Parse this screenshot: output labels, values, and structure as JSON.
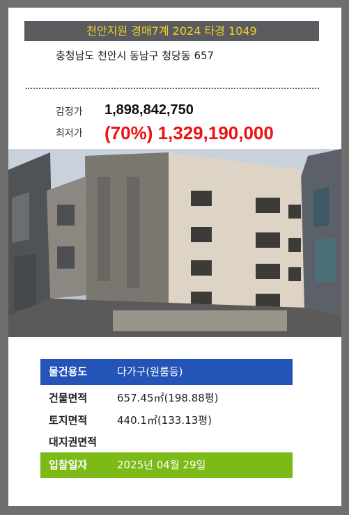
{
  "header": {
    "title": "천안지원 경매7계 2024 타경 1049"
  },
  "property": {
    "address": "충청남도 천안시 동남구 청당동 657",
    "appraisal_label": "감정가",
    "appraisal_value": "1,898,842,750",
    "min_price_label": "최저가",
    "min_price_value": "(70%) 1,329,190,000"
  },
  "details": [
    {
      "label": "물건용도",
      "value": "다가구(원룸등)"
    },
    {
      "label": "건물면적",
      "value": "657.45㎡(198.88평)"
    },
    {
      "label": "토지면적",
      "value": "440.1㎡(133.13평)"
    },
    {
      "label": "대지권면적",
      "value": ""
    },
    {
      "label": "입찰일자",
      "value": "2025년 04월 29일"
    }
  ],
  "colors": {
    "title_bg": "#595b5e",
    "title_text": "#f4cf2a",
    "usage_bg": "#2454b8",
    "bid_bg": "#7cba18",
    "min_price": "#ee1111"
  }
}
